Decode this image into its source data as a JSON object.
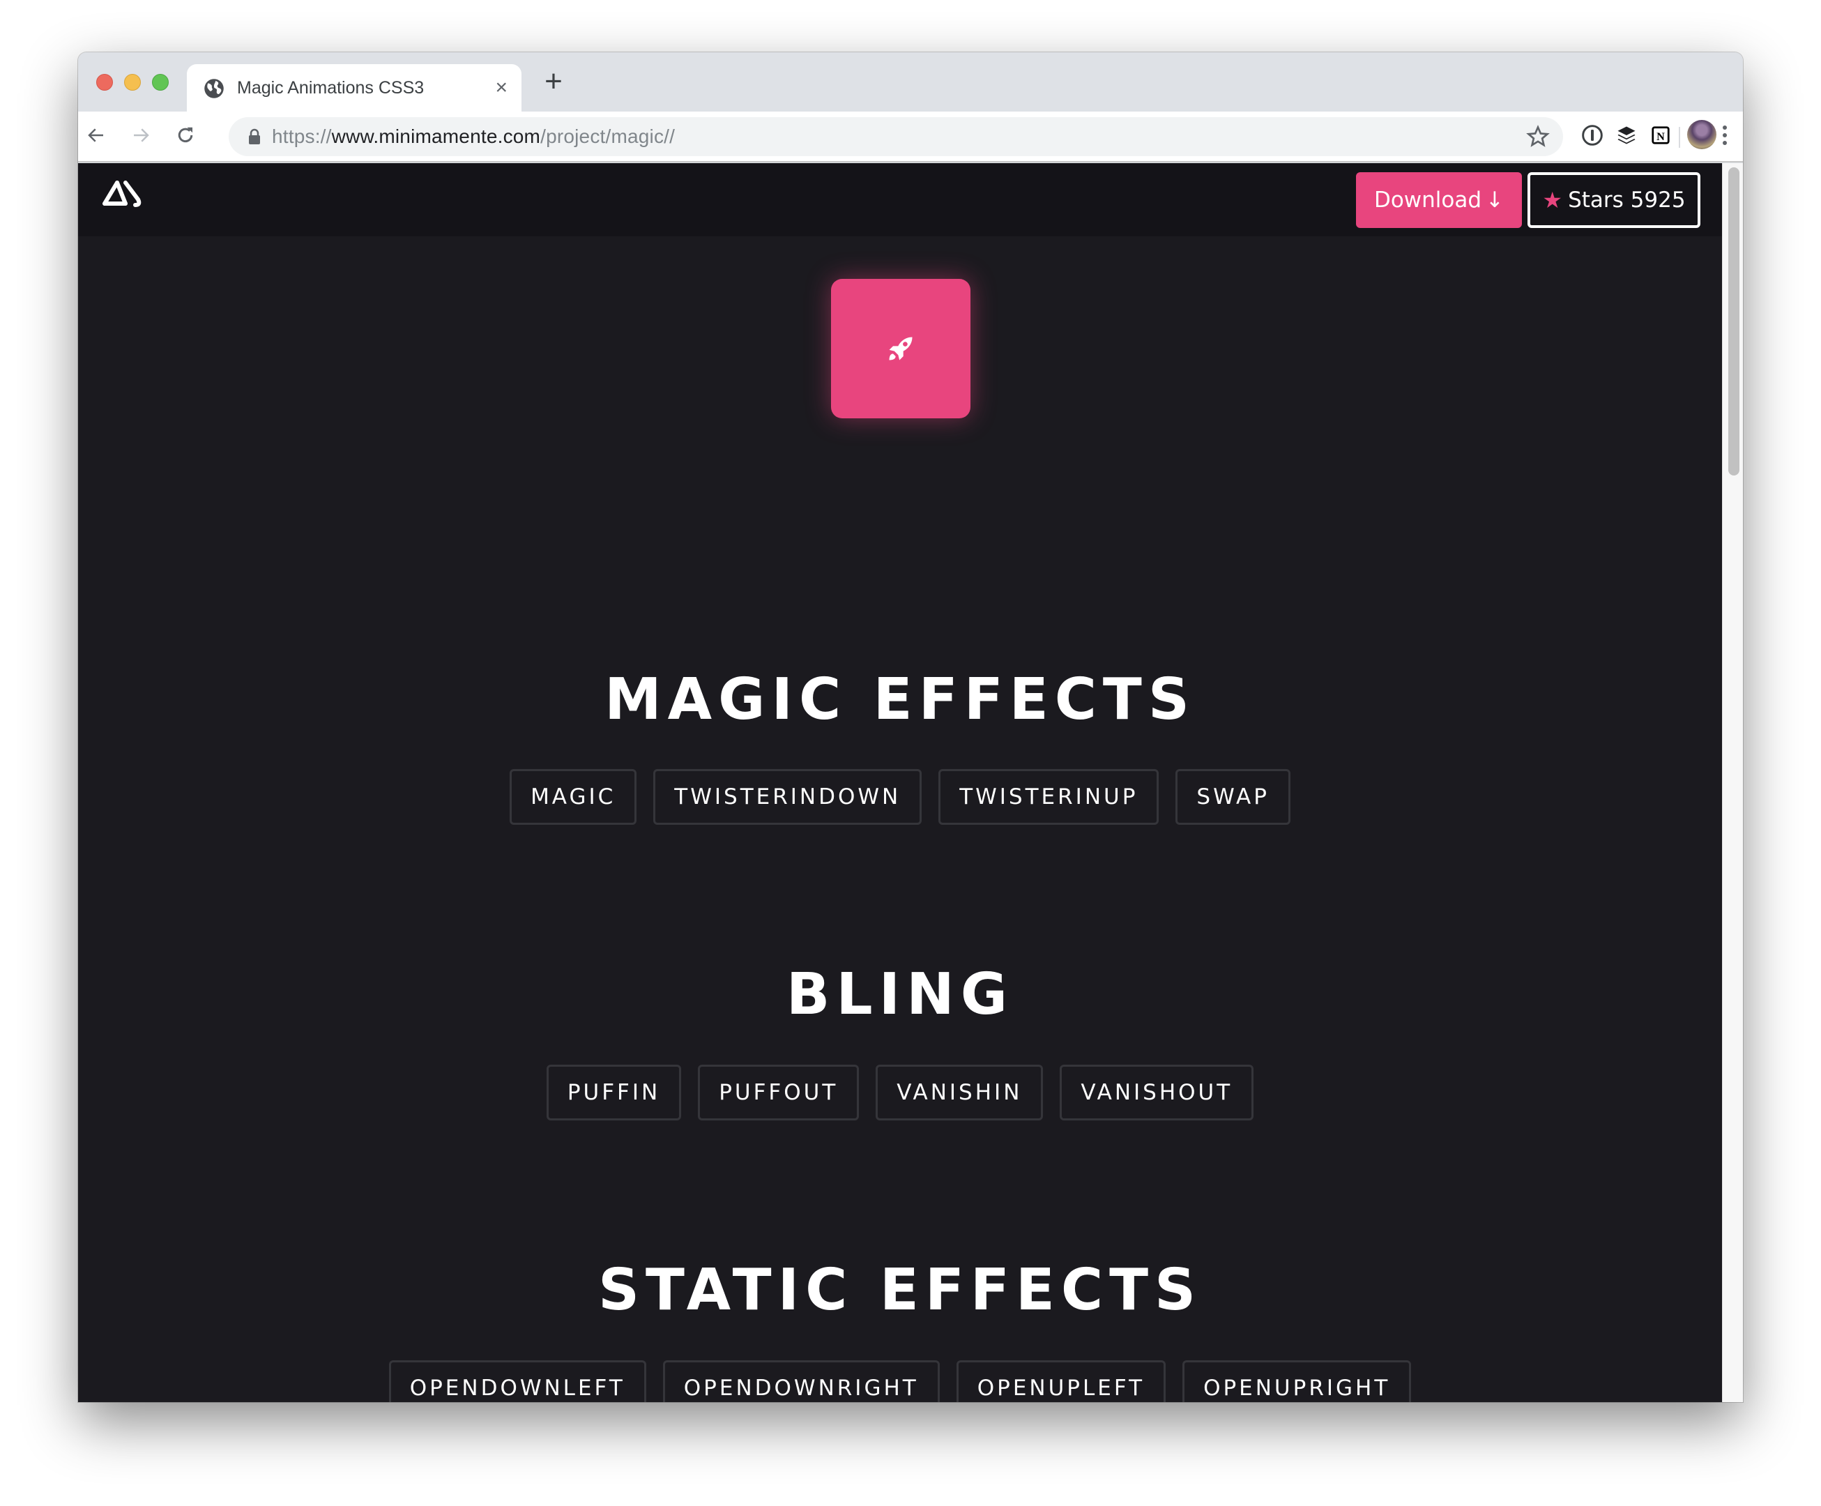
{
  "browser": {
    "tab": {
      "title": "Magic Animations CSS3",
      "favicon": "globe-icon",
      "close_glyph": "×"
    },
    "new_tab_glyph": "+",
    "url": {
      "scheme": "https://",
      "host": "www.minimamente.com",
      "path": "/project/magic//"
    },
    "toolbar_icons": [
      "back-arrow-icon",
      "forward-arrow-icon",
      "reload-icon",
      "lock-icon",
      "bookmark-star-icon",
      "1password-icon",
      "buffer-icon",
      "notion-icon",
      "profile-avatar",
      "menu-dots-icon"
    ],
    "extensions": {
      "notion_glyph": "N"
    }
  },
  "site": {
    "logo": "minimamente-logo",
    "download_label": "Download",
    "download_icon_glyph": "↓",
    "stars_icon_glyph": "★",
    "stars_label": "Stars 5925",
    "hero_icon": "rocket-icon",
    "colors": {
      "accent": "#e8457e",
      "page_bg": "#1b1a1f",
      "nav_bg": "#141318",
      "button_border": "#35353a"
    }
  },
  "sections": [
    {
      "title": "MAGIC EFFECTS",
      "buttons": [
        "MAGIC",
        "TWISTERINDOWN",
        "TWISTERINUP",
        "SWAP"
      ]
    },
    {
      "title": "BLING",
      "buttons": [
        "PUFFIN",
        "PUFFOUT",
        "VANISHIN",
        "VANISHOUT"
      ]
    },
    {
      "title": "STATIC EFFECTS",
      "buttons": [
        "OPENDOWNLEFT",
        "OPENDOWNRIGHT",
        "OPENUPLEFT",
        "OPENUPRIGHT"
      ]
    }
  ],
  "partial_row_buttons": [
    "",
    "",
    ""
  ]
}
